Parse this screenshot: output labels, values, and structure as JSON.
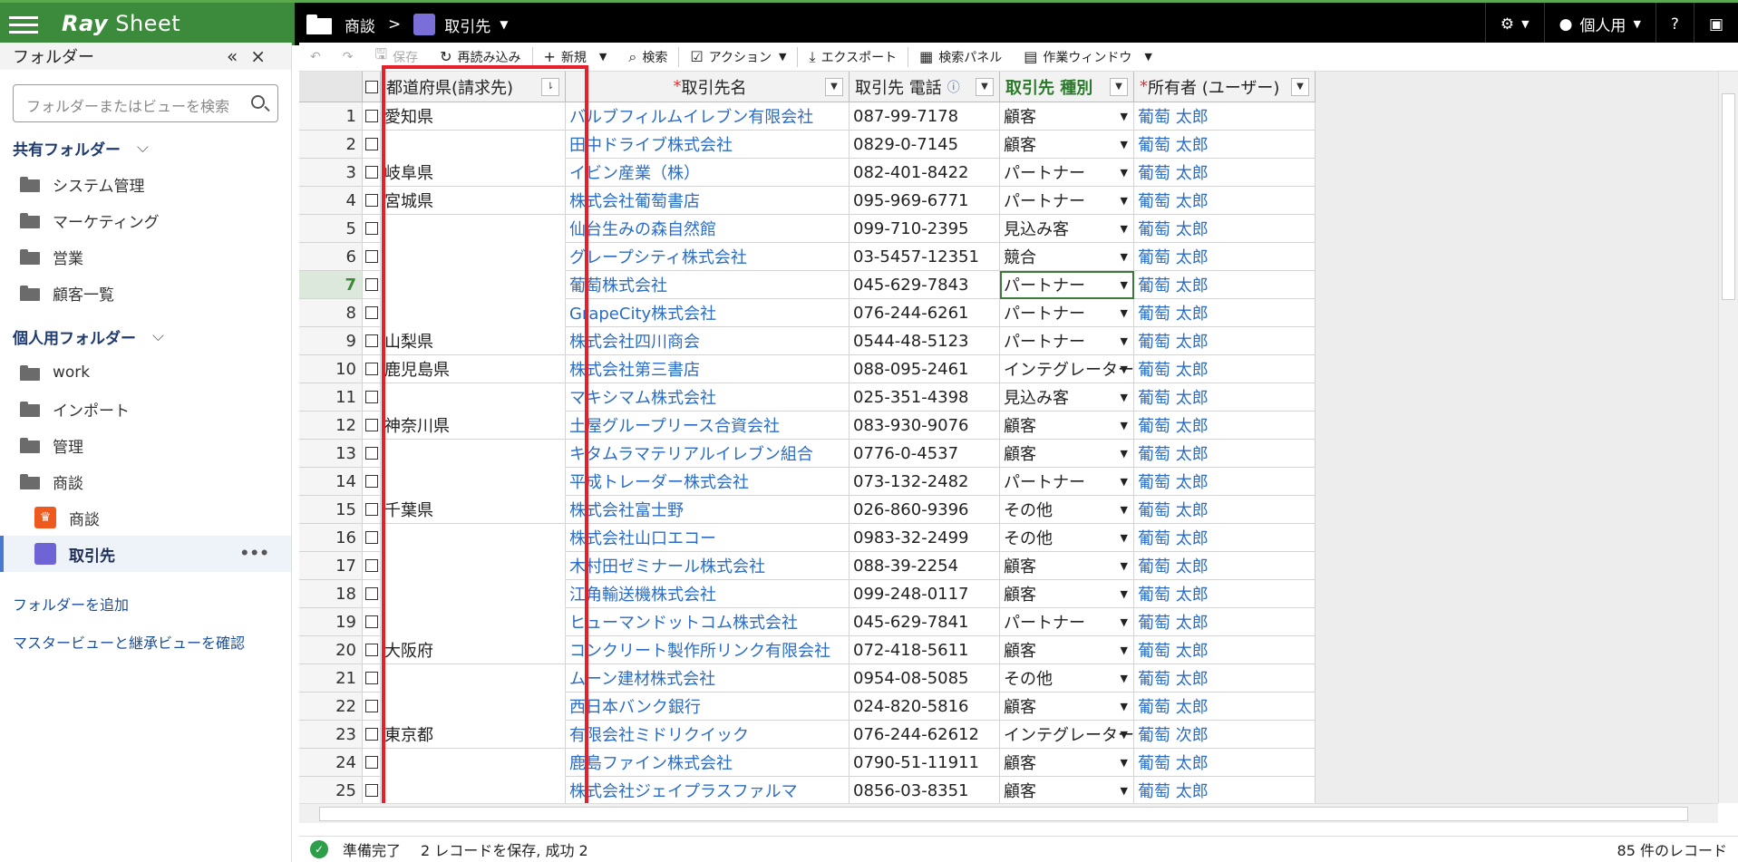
{
  "app": {
    "name_a": "Ray",
    "name_b": "Sheet"
  },
  "breadcrumb": {
    "folder": "商談",
    "sep": ">",
    "view": "取引先"
  },
  "topbar": {
    "user": "個人用",
    "help": "?"
  },
  "sidebar": {
    "title": "フォルダー",
    "search_placeholder": "フォルダーまたはビューを検索",
    "shared_title": "共有フォルダー",
    "shared": [
      "システム管理",
      "マーケティング",
      "営業",
      "顧客一覧"
    ],
    "personal_title": "個人用フォルダー",
    "personal": [
      "work",
      "インポート",
      "管理",
      "商談"
    ],
    "sub_items": [
      "商談",
      "取引先"
    ],
    "add_folder": "フォルダーを追加",
    "master_view": "マスタービューと継承ビューを確認"
  },
  "toolbar": {
    "save": "保存",
    "reload": "再読み込み",
    "new": "新規",
    "search": "検索",
    "action": "アクション",
    "export": "エクスポート",
    "search_panel": "検索パネル",
    "work_window": "作業ウィンドウ"
  },
  "columns": [
    "都道府県(請求先)",
    "取引先名",
    "取引先 電話",
    "取引先 種別",
    "所有者 (ユーザー)"
  ],
  "rows": [
    [
      "1",
      "愛知県",
      "バルブフィルムイレブン有限会社",
      "087-99-7178",
      "顧客",
      "葡萄 太郎"
    ],
    [
      "2",
      "",
      "田中ドライブ株式会社",
      "0829-0-7145",
      "顧客",
      "葡萄 太郎"
    ],
    [
      "3",
      "岐阜県",
      "イビン産業（株）",
      "082-401-8422",
      "パートナー",
      "葡萄 太郎"
    ],
    [
      "4",
      "宮城県",
      "株式会社葡萄書店",
      "095-969-6771",
      "パートナー",
      "葡萄 太郎"
    ],
    [
      "5",
      "",
      "仙台生みの森自然館",
      "099-710-2395",
      "見込み客",
      "葡萄 太郎"
    ],
    [
      "6",
      "",
      "グレープシティ株式会社",
      "03-5457-12351",
      "競合",
      "葡萄 太郎"
    ],
    [
      "7",
      "",
      "葡萄株式会社",
      "045-629-7843",
      "パートナー",
      "葡萄 太郎"
    ],
    [
      "8",
      "",
      "GrapeCity株式会社",
      "076-244-6261",
      "パートナー",
      "葡萄 太郎"
    ],
    [
      "9",
      "山梨県",
      "株式会社四川商会",
      "0544-48-5123",
      "パートナー",
      "葡萄 太郎"
    ],
    [
      "10",
      "鹿児島県",
      "株式会社第三書店",
      "088-095-2461",
      "インテグレーター",
      "葡萄 太郎"
    ],
    [
      "11",
      "",
      "マキシマム株式会社",
      "025-351-4398",
      "見込み客",
      "葡萄 太郎"
    ],
    [
      "12",
      "神奈川県",
      "土屋グループリース合資会社",
      "083-930-9076",
      "顧客",
      "葡萄 太郎"
    ],
    [
      "13",
      "",
      "キタムラマテリアルイレブン組合",
      "0776-0-4537",
      "顧客",
      "葡萄 太郎"
    ],
    [
      "14",
      "",
      "平成トレーダー株式会社",
      "073-132-2482",
      "パートナー",
      "葡萄 太郎"
    ],
    [
      "15",
      "千葉県",
      "株式会社富士野",
      "026-860-9396",
      "その他",
      "葡萄 太郎"
    ],
    [
      "16",
      "",
      "株式会社山口エコー",
      "0983-32-2499",
      "その他",
      "葡萄 太郎"
    ],
    [
      "17",
      "",
      "木村田ゼミナール株式会社",
      "088-39-2254",
      "顧客",
      "葡萄 太郎"
    ],
    [
      "18",
      "",
      "江角輸送機株式会社",
      "099-248-0117",
      "顧客",
      "葡萄 太郎"
    ],
    [
      "19",
      "",
      "ヒューマンドットコム株式会社",
      "045-629-7841",
      "パートナー",
      "葡萄 太郎"
    ],
    [
      "20",
      "大阪府",
      "コンクリート製作所リンク有限会社",
      "072-418-5611",
      "顧客",
      "葡萄 太郎"
    ],
    [
      "21",
      "",
      "ムーン建材株式会社",
      "0954-08-5085",
      "その他",
      "葡萄 太郎"
    ],
    [
      "22",
      "",
      "西日本バンク銀行",
      "024-820-5816",
      "顧客",
      "葡萄 太郎"
    ],
    [
      "23",
      "東京都",
      "有限会社ミドリクイック",
      "076-244-62612",
      "インテグレーター",
      "葡萄 次郎"
    ],
    [
      "24",
      "",
      "鹿島ファイン株式会社",
      "0790-51-11911",
      "顧客",
      "葡萄 太郎"
    ],
    [
      "25",
      "",
      "株式会社ジェイプラスファルマ",
      "0856-03-8351",
      "顧客",
      "葡萄 太郎"
    ]
  ],
  "selected_row": 7,
  "status": {
    "text": "準備完了",
    "detail": "2 レコードを保存, 成功 2",
    "count": "85 件のレコード"
  }
}
